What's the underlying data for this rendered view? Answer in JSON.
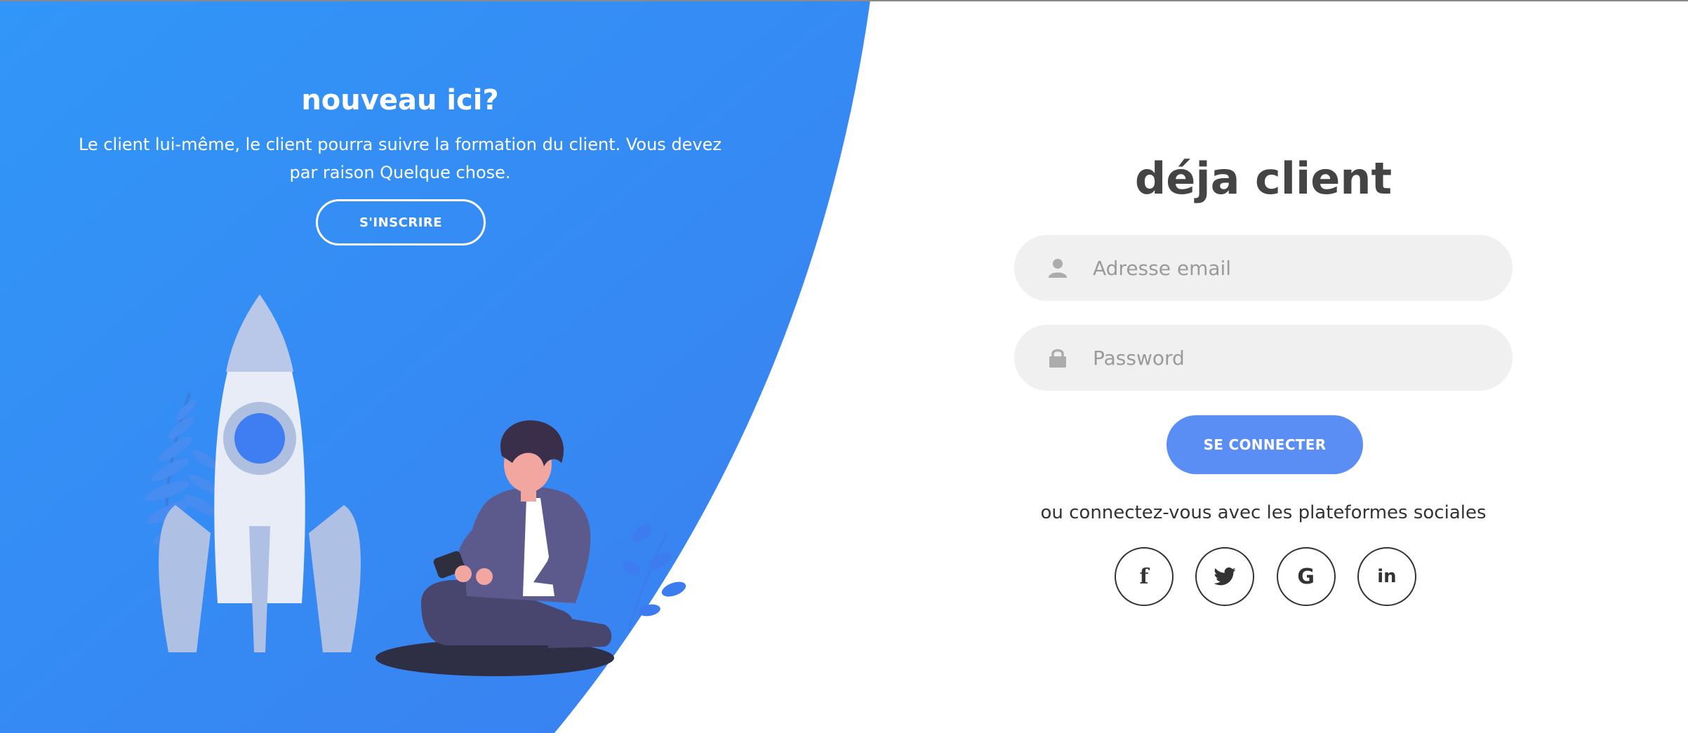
{
  "theme": {
    "accent": "#2f8af3",
    "accent_light": "#3b92f5",
    "button_blue": "#5b8ef5",
    "input_bg": "#f0f0f0",
    "title_color": "#444444"
  },
  "signup_panel": {
    "title": "nouveau ici?",
    "description": "Le client lui-même, le client pourra suivre la formation du client. Vous devez par raison Quelque chose.",
    "signup_label": "S'INSCRIRE"
  },
  "login_panel": {
    "title": "déja client",
    "email": {
      "placeholder": "Adresse email",
      "value": "",
      "icon": "user-icon"
    },
    "password": {
      "placeholder": "Password",
      "value": "",
      "icon": "lock-icon"
    },
    "login_label": "SE CONNECTER",
    "social_text": "ou connectez-vous avec les plateformes sociales",
    "social": [
      {
        "name": "facebook",
        "glyph": "f",
        "icon": "facebook-icon"
      },
      {
        "name": "twitter",
        "glyph": "",
        "icon": "twitter-icon"
      },
      {
        "name": "google",
        "glyph": "G",
        "icon": "google-icon"
      },
      {
        "name": "linkedin",
        "glyph": "in",
        "icon": "linkedin-icon"
      }
    ]
  }
}
